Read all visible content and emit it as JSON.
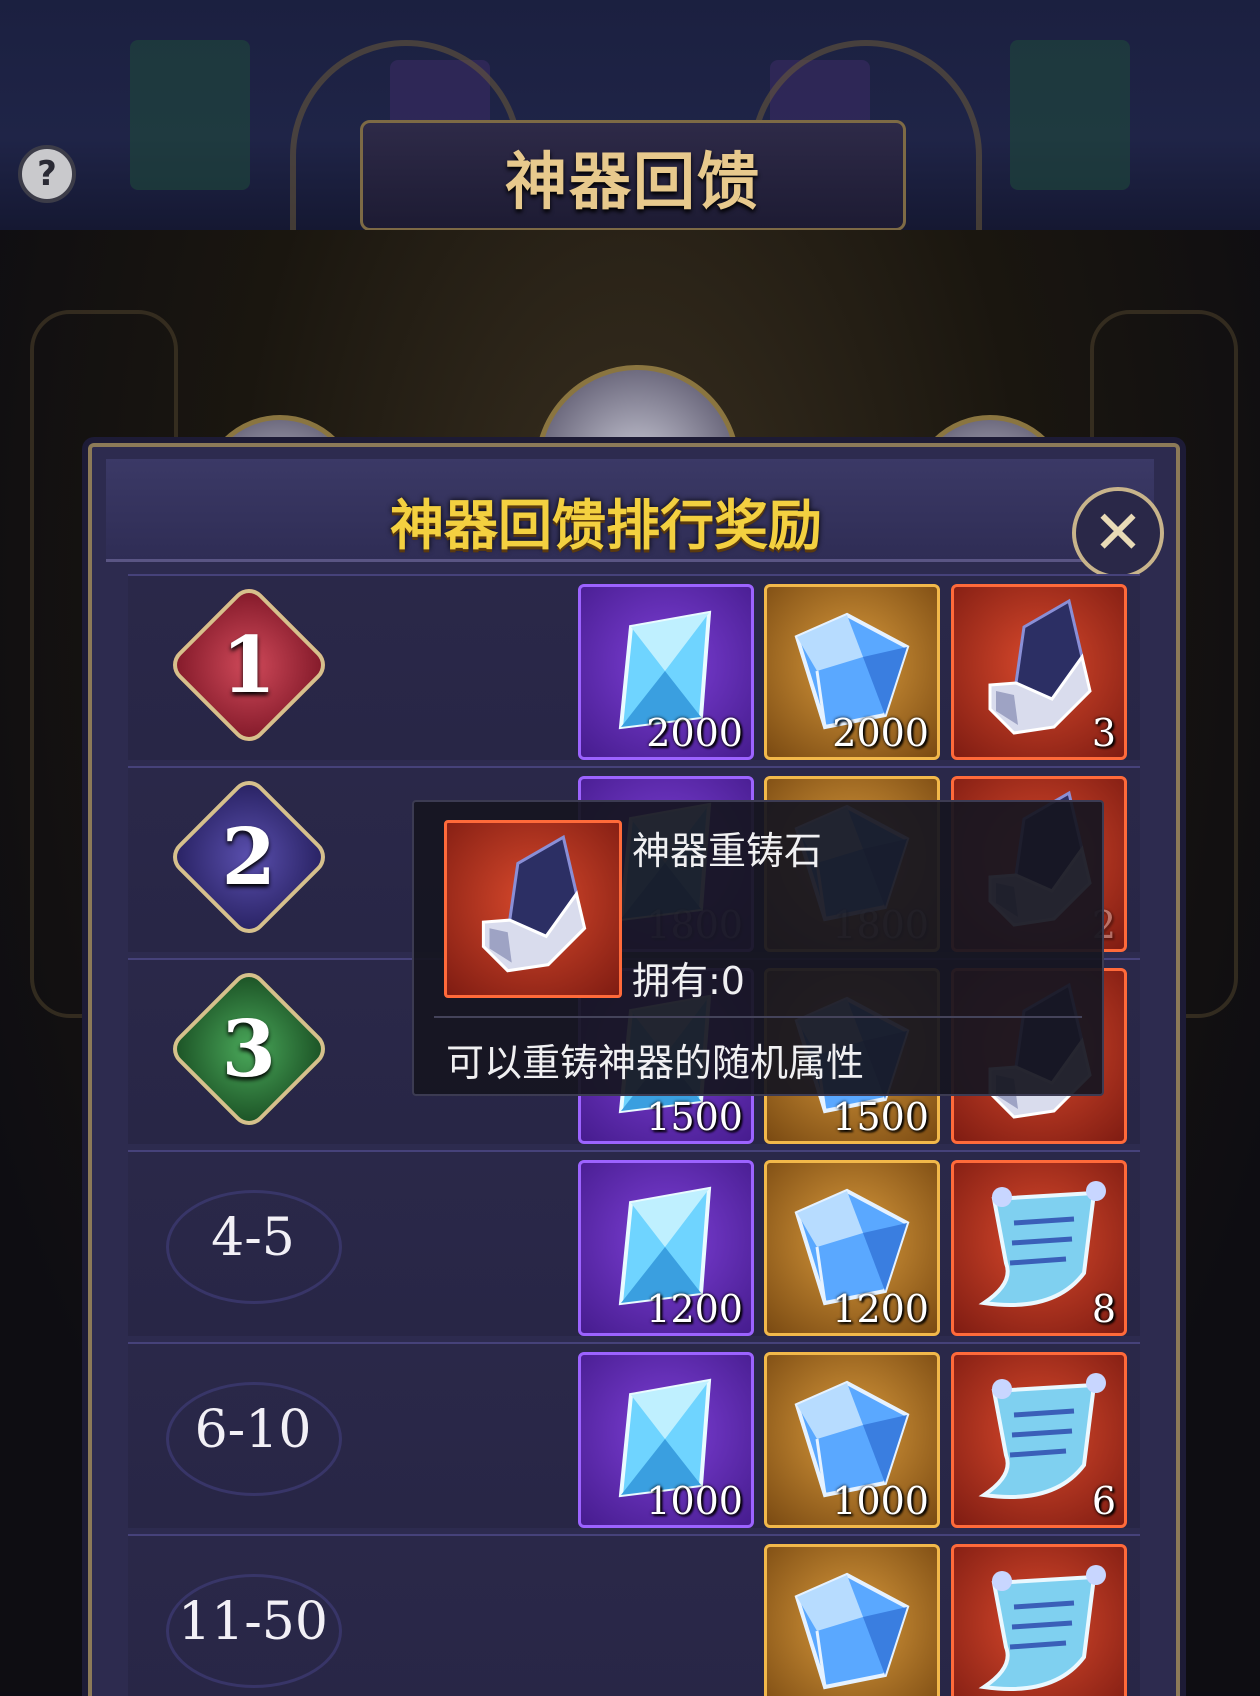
{
  "header": {
    "title": "神器回馈",
    "help_glyph": "?"
  },
  "panel": {
    "title": "神器回馈排行奖励",
    "close_glyph": "✕"
  },
  "rows": [
    {
      "rank": "1",
      "rewards": [
        {
          "item": "purple-crystal",
          "qty": "2000"
        },
        {
          "item": "gold-diamond",
          "qty": "2000"
        },
        {
          "item": "artifact-reforge-stone",
          "qty": "3"
        }
      ]
    },
    {
      "rank": "2",
      "rewards": [
        {
          "item": "purple-crystal",
          "qty": "1800"
        },
        {
          "item": "gold-diamond",
          "qty": "1800"
        },
        {
          "item": "artifact-reforge-stone",
          "qty": "2"
        }
      ]
    },
    {
      "rank": "3",
      "rewards": [
        {
          "item": "purple-crystal",
          "qty": "1500"
        },
        {
          "item": "gold-diamond",
          "qty": "1500"
        },
        {
          "item": "artifact-reforge-stone",
          "qty": ""
        }
      ]
    },
    {
      "rank": "4-5",
      "rewards": [
        {
          "item": "purple-crystal",
          "qty": "1200"
        },
        {
          "item": "gold-diamond",
          "qty": "1200"
        },
        {
          "item": "scroll",
          "qty": "8"
        }
      ]
    },
    {
      "rank": "6-10",
      "rewards": [
        {
          "item": "purple-crystal",
          "qty": "1000"
        },
        {
          "item": "gold-diamond",
          "qty": "1000"
        },
        {
          "item": "scroll",
          "qty": "6"
        }
      ]
    },
    {
      "rank": "11-50",
      "rewards": [
        {
          "item": "gold-diamond",
          "qty": ""
        },
        {
          "item": "scroll",
          "qty": ""
        }
      ]
    }
  ],
  "tooltip": {
    "name": "神器重铸石",
    "owned": "拥有:0",
    "description": "可以重铸神器的随机属性"
  },
  "colors": {
    "panel_title": "#f3d040",
    "purple_frame": "#9c63ff",
    "gold_frame": "#f2b84a",
    "red_frame": "#ff6a3a"
  }
}
